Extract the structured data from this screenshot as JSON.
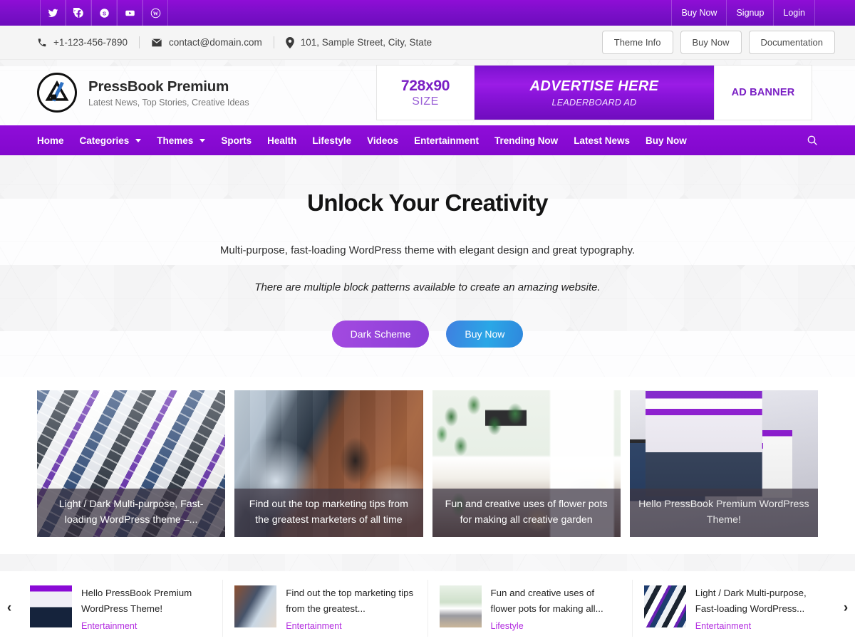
{
  "topbar": {
    "social": [
      {
        "name": "twitter-icon",
        "label": "Twitter"
      },
      {
        "name": "facebook-icon",
        "label": "Facebook"
      },
      {
        "name": "skype-icon",
        "label": "Skype"
      },
      {
        "name": "youtube-icon",
        "label": "YouTube"
      },
      {
        "name": "wordpress-icon",
        "label": "WordPress"
      }
    ],
    "links": [
      "Buy Now",
      "Signup",
      "Login"
    ]
  },
  "contactbar": {
    "phone": "+1-123-456-7890",
    "email": "contact@domain.com",
    "address": "101, Sample Street, City, State",
    "buttons": [
      "Theme Info",
      "Buy Now",
      "Documentation"
    ]
  },
  "masthead": {
    "site_title": "PressBook Premium",
    "tagline": "Latest News, Top Stories, Creative Ideas",
    "ad": {
      "size_big": "728x90",
      "size_small": "SIZE",
      "headline": "ADVERTISE HERE",
      "subline": "LEADERBOARD AD",
      "right_label": "AD BANNER"
    }
  },
  "nav": {
    "items": [
      {
        "label": "Home",
        "caret": false
      },
      {
        "label": "Categories",
        "caret": true
      },
      {
        "label": "Themes",
        "caret": true
      },
      {
        "label": "Sports",
        "caret": false
      },
      {
        "label": "Health",
        "caret": false
      },
      {
        "label": "Lifestyle",
        "caret": false
      },
      {
        "label": "Videos",
        "caret": false
      },
      {
        "label": "Entertainment",
        "caret": false
      },
      {
        "label": "Trending Now",
        "caret": false
      },
      {
        "label": "Latest News",
        "caret": false
      },
      {
        "label": "Buy Now",
        "caret": false
      }
    ],
    "search_icon": "search-icon"
  },
  "hero": {
    "heading": "Unlock Your Creativity",
    "subtext_1": "Multi-purpose, fast-loading WordPress theme with elegant design and great typography.",
    "subtext_2": "There are multiple block patterns available to create an amazing website.",
    "button_primary": "Dark Scheme",
    "button_secondary": "Buy Now"
  },
  "features": [
    {
      "caption": "Light / Dark Multi-purpose, Fast-loading WordPress theme –...",
      "art": "art-mockups"
    },
    {
      "caption": "Find out the top marketing tips from the greatest marketers of all time",
      "art": "art-desk"
    },
    {
      "caption": "Fun and creative uses of flower pots for making all creative garden",
      "art": "art-room"
    },
    {
      "caption": "Hello PressBook Premium WordPress Theme!",
      "art": "art-devices"
    }
  ],
  "carousel": {
    "prev_label": "‹",
    "next_label": "›",
    "items": [
      {
        "title": "Hello PressBook Premium WordPress Theme!",
        "category": "Entertainment",
        "thumb": "th-devices"
      },
      {
        "title": "Find out the top marketing tips from the greatest...",
        "category": "Entertainment",
        "thumb": "th-desk"
      },
      {
        "title": "Fun and creative uses of flower pots for making all...",
        "category": "Lifestyle",
        "thumb": "th-room"
      },
      {
        "title": "Light / Dark Multi-purpose, Fast-loading WordPress...",
        "category": "Entertainment",
        "thumb": "th-mock"
      }
    ]
  },
  "colors": {
    "brand_purple": "#8a0ad6",
    "top_purple": "#7b0fc9",
    "accent_link": "#b32ee0",
    "ad_purple": "#7a1fc4"
  }
}
